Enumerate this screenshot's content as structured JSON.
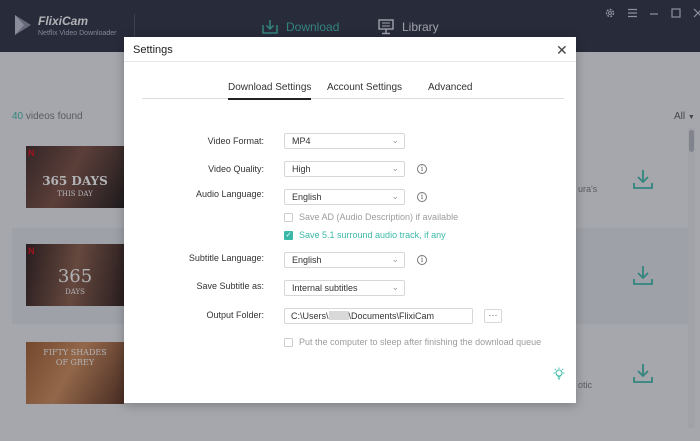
{
  "app": {
    "name": "FlixiCam",
    "subtitle": "Netflix Video Downloader",
    "nav": {
      "download": "Download",
      "library": "Library"
    },
    "accent_color": "#3bb9a8"
  },
  "list": {
    "count_number": "40",
    "count_text": " videos found",
    "filter": "All",
    "rows": [
      {
        "thumb_title": "365 DAYS",
        "thumb_subtitle": "THIS DAY",
        "snippet": "ura's"
      },
      {
        "thumb_title": "365",
        "thumb_subtitle": "DAYS",
        "snippet": ""
      },
      {
        "thumb_title": "FIFTY SHADES",
        "thumb_subtitle": "OF GREY",
        "snippet": "otic"
      }
    ]
  },
  "settings": {
    "title": "Settings",
    "tabs": [
      "Download Settings",
      "Account Settings",
      "Advanced"
    ],
    "active_tab": "Download Settings",
    "video_format": {
      "label": "Video Format:",
      "value": "MP4"
    },
    "video_quality": {
      "label": "Video Quality:",
      "value": "High"
    },
    "audio_language": {
      "label": "Audio Language:",
      "value": "English"
    },
    "save_ad": {
      "label": "Save AD (Audio Description) if available",
      "checked": false
    },
    "save_51": {
      "label": "Save 5.1 surround audio track, if any",
      "checked": true
    },
    "subtitle_language": {
      "label": "Subtitle Language:",
      "value": "English"
    },
    "save_subtitle": {
      "label": "Save Subtitle as:",
      "value": "Internal subtitles"
    },
    "output_folder": {
      "label": "Output Folder:",
      "prefix": "C:\\Users\\",
      "suffix": "\\Documents\\FlixiCam",
      "browse": "···"
    },
    "sleep": {
      "label": "Put the computer to sleep after finishing the download queue",
      "checked": false
    }
  }
}
